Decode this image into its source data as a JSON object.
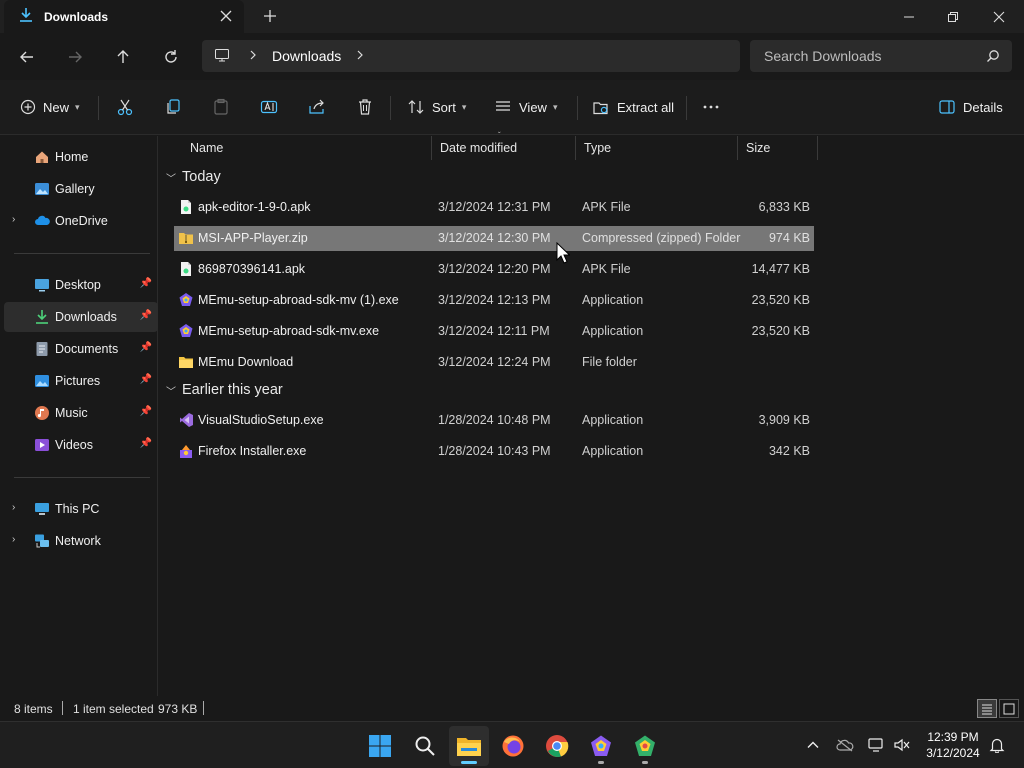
{
  "window": {
    "tab_title": "Downloads"
  },
  "nav": {
    "breadcrumb": [
      "Downloads"
    ],
    "search_placeholder": "Search Downloads"
  },
  "commands": {
    "new": "New",
    "sort": "Sort",
    "view": "View",
    "extract_all": "Extract all",
    "details": "Details"
  },
  "sidebar": {
    "quick": [
      {
        "label": "Home",
        "icon": "home-icon"
      },
      {
        "label": "Gallery",
        "icon": "gallery-icon"
      },
      {
        "label": "OneDrive",
        "icon": "onedrive-icon"
      }
    ],
    "pinned": [
      {
        "label": "Desktop",
        "icon": "desktop-icon"
      },
      {
        "label": "Downloads",
        "icon": "downloads-icon"
      },
      {
        "label": "Documents",
        "icon": "documents-icon"
      },
      {
        "label": "Pictures",
        "icon": "pictures-icon"
      },
      {
        "label": "Music",
        "icon": "music-icon"
      },
      {
        "label": "Videos",
        "icon": "videos-icon"
      }
    ],
    "devices": [
      {
        "label": "This PC",
        "icon": "this-pc-icon"
      },
      {
        "label": "Network",
        "icon": "network-icon"
      }
    ]
  },
  "columns": {
    "name": "Name",
    "date": "Date modified",
    "type": "Type",
    "size": "Size"
  },
  "groups": [
    {
      "label": "Today",
      "files": [
        {
          "name": "apk-editor-1-9-0.apk",
          "date": "3/12/2024 12:31 PM",
          "type": "APK File",
          "size": "6,833 KB",
          "icon": "apk-file-icon",
          "selected": false
        },
        {
          "name": "MSI-APP-Player.zip",
          "date": "3/12/2024 12:30 PM",
          "type": "Compressed (zipped) Folder",
          "size": "974 KB",
          "icon": "zip-folder-icon",
          "selected": true
        },
        {
          "name": "869870396141.apk",
          "date": "3/12/2024 12:20 PM",
          "type": "APK File",
          "size": "14,477 KB",
          "icon": "apk-file-icon",
          "selected": false
        },
        {
          "name": "MEmu-setup-abroad-sdk-mv (1).exe",
          "date": "3/12/2024 12:13 PM",
          "type": "Application",
          "size": "23,520 KB",
          "icon": "memu-app-icon",
          "selected": false
        },
        {
          "name": "MEmu-setup-abroad-sdk-mv.exe",
          "date": "3/12/2024 12:11 PM",
          "type": "Application",
          "size": "23,520 KB",
          "icon": "memu-app-icon",
          "selected": false
        },
        {
          "name": "MEmu Download",
          "date": "3/12/2024 12:24 PM",
          "type": "File folder",
          "size": "",
          "icon": "folder-icon",
          "selected": false
        }
      ]
    },
    {
      "label": "Earlier this year",
      "files": [
        {
          "name": "VisualStudioSetup.exe",
          "date": "1/28/2024 10:48 PM",
          "type": "Application",
          "size": "3,909 KB",
          "icon": "visual-studio-icon",
          "selected": false
        },
        {
          "name": "Firefox Installer.exe",
          "date": "1/28/2024 10:43 PM",
          "type": "Application",
          "size": "342 KB",
          "icon": "firefox-installer-icon",
          "selected": false
        }
      ]
    }
  ],
  "status": {
    "items": "8 items",
    "selected": "1 item selected",
    "selected_size": "973 KB"
  },
  "clock": {
    "time": "12:39 PM",
    "date": "3/12/2024"
  },
  "colors": {
    "accent": "#60cdff",
    "selection": "#777777",
    "background": "#191919"
  }
}
